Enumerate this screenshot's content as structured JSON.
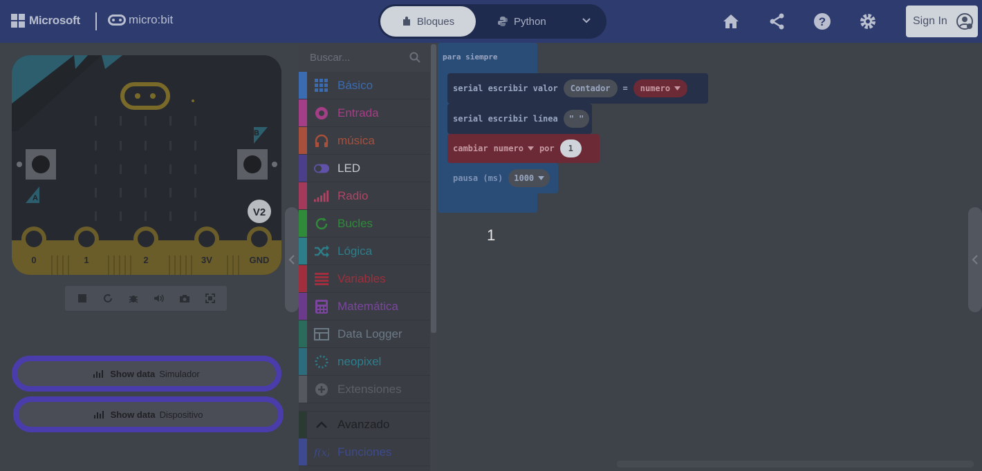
{
  "header": {
    "brand": "Microsoft",
    "product": "micro:bit",
    "modes": {
      "blocks": "Bloques",
      "python": "Python"
    },
    "signin": "Sign In"
  },
  "simulator": {
    "badge": "V2",
    "button_a": "A",
    "button_b": "B",
    "pins": [
      "0",
      "1",
      "2",
      "3V",
      "GND"
    ]
  },
  "show_data": [
    {
      "label": "Show data",
      "target": "Simulador"
    },
    {
      "label": "Show data",
      "target": "Dispositivo"
    }
  ],
  "toolbox": {
    "search_placeholder": "Buscar...",
    "categories": [
      {
        "label": "Básico",
        "color": "#3b6bb0"
      },
      {
        "label": "Entrada",
        "color": "#a43e86"
      },
      {
        "label": "música",
        "color": "#a8503c"
      },
      {
        "label": "LED",
        "color": "#4c3f8a"
      },
      {
        "label": "Radio",
        "color": "#a33a5c"
      },
      {
        "label": "Bucles",
        "color": "#2f8a3a"
      },
      {
        "label": "Lógica",
        "color": "#2e7e8a"
      },
      {
        "label": "Variables",
        "color": "#a02e3c"
      },
      {
        "label": "Matemática",
        "color": "#6b3a8a"
      },
      {
        "label": "Data Logger",
        "color": "#2b6b5c"
      },
      {
        "label": "neopixel",
        "color": "#2c6c7c"
      },
      {
        "label": "Extensiones",
        "color": "#55585e"
      }
    ],
    "advanced": "Avanzado",
    "functions": "Funciones"
  },
  "workspace": {
    "forever": "para siempre",
    "serial_write_value": "serial escribir valor",
    "value_name": "Contador",
    "equals": "=",
    "var_name": "numero",
    "serial_write_line": "serial escribir línea",
    "line_text": "\" \"",
    "change": "cambiar",
    "change_var": "numero",
    "by": "por",
    "by_value": "1",
    "pause": "pausa (ms)",
    "pause_value": "1000"
  },
  "output": "1"
}
